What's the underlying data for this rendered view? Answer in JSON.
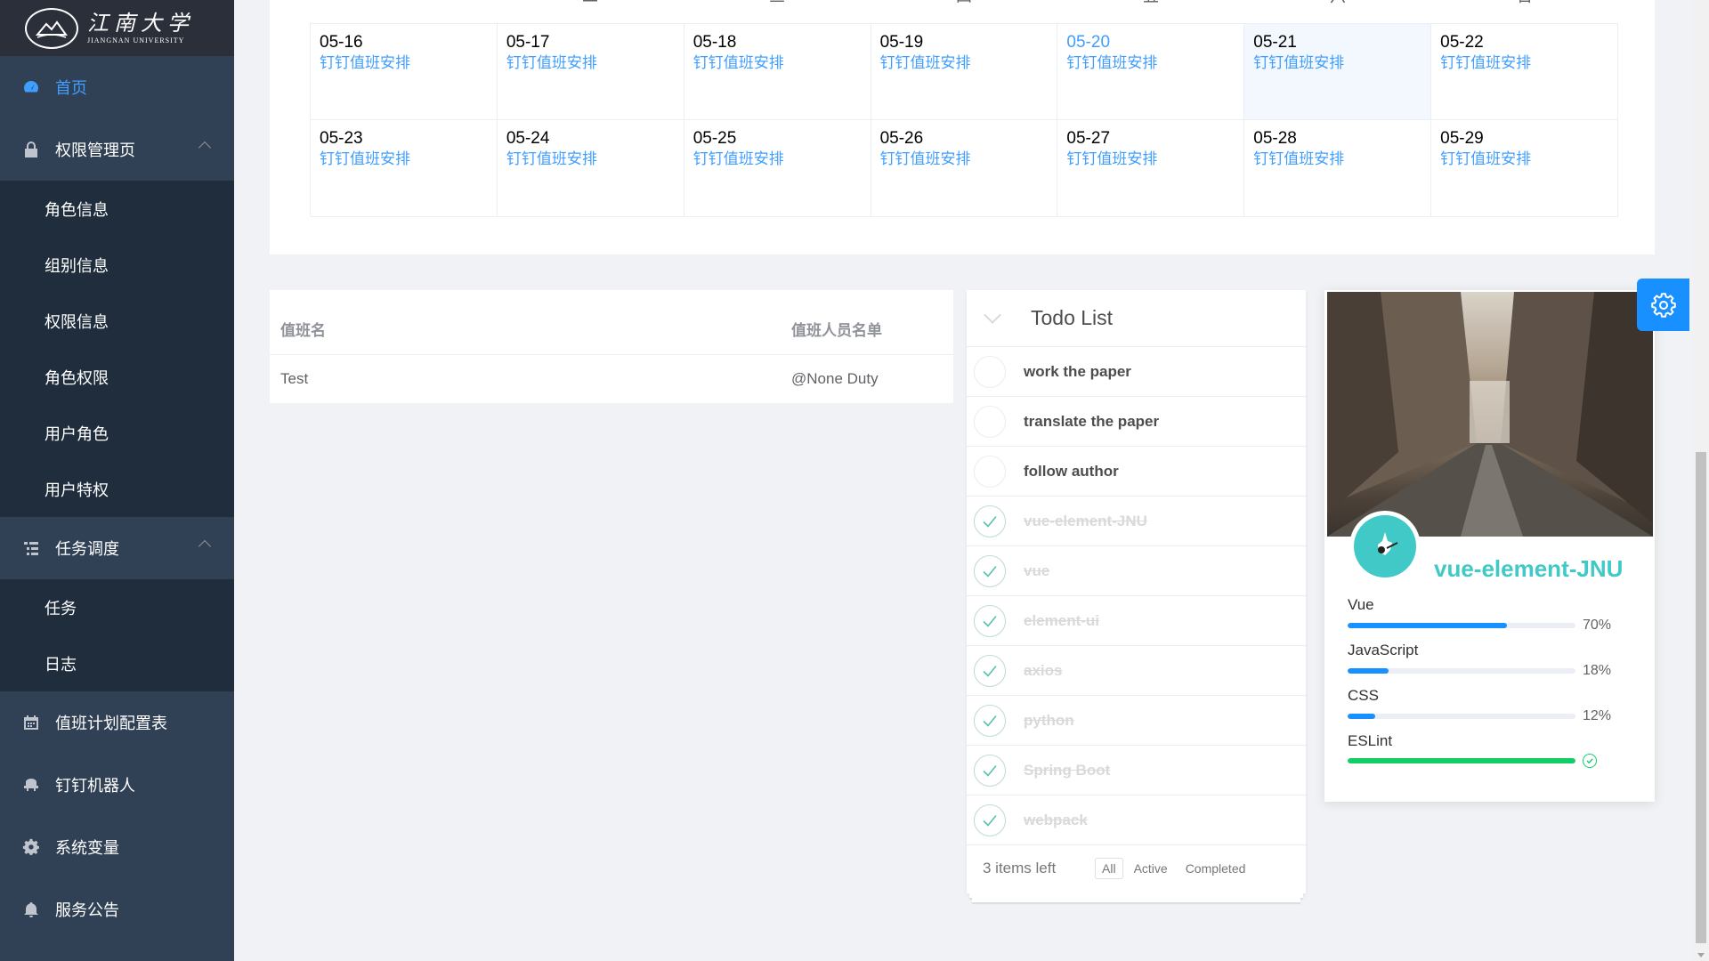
{
  "sidebar": {
    "logo": {
      "cn": "江南大学",
      "en": "JIANGNAN UNIVERSITY"
    },
    "home": {
      "label": "首页",
      "icon": "dashboard-icon"
    },
    "perm_group": {
      "label": "权限管理页",
      "icon": "lock-icon",
      "items": [
        "角色信息",
        "组别信息",
        "权限信息",
        "角色权限",
        "用户角色",
        "用户特权"
      ]
    },
    "task_group": {
      "label": "任务调度",
      "icon": "tree-table-icon",
      "items": [
        "任务",
        "日志"
      ]
    },
    "duty_plan": {
      "label": "值班计划配置表",
      "icon": "calendar-icon"
    },
    "dingtalk": {
      "label": "钉钉机器人",
      "icon": "robot-icon"
    },
    "sysvars": {
      "label": "系统变量",
      "icon": "gear-icon"
    },
    "notice": {
      "label": "服务公告",
      "icon": "bell-icon"
    }
  },
  "calendar": {
    "weekdays": [
      "二",
      "三",
      "四",
      "五",
      "六",
      "日"
    ],
    "today": "05-20",
    "selected": "05-21",
    "event_label": "钉钉值班安排",
    "rows": [
      [
        "05-16",
        "05-17",
        "05-18",
        "05-19",
        "05-20",
        "05-21",
        "05-22"
      ],
      [
        "05-23",
        "05-24",
        "05-25",
        "05-26",
        "05-27",
        "05-28",
        "05-29"
      ]
    ]
  },
  "duty_table": {
    "headers": [
      "值班名",
      "值班人员名单"
    ],
    "rows": [
      [
        "Test",
        "@None Duty"
      ]
    ]
  },
  "todo": {
    "title": "Todo List",
    "items": [
      {
        "text": "work the paper",
        "done": false
      },
      {
        "text": "translate the paper",
        "done": false
      },
      {
        "text": "follow author",
        "done": false
      },
      {
        "text": "vue-element-JNU",
        "done": true
      },
      {
        "text": "vue",
        "done": true
      },
      {
        "text": "element-ui",
        "done": true
      },
      {
        "text": "axios",
        "done": true
      },
      {
        "text": "python",
        "done": true
      },
      {
        "text": "Spring Boot",
        "done": true
      },
      {
        "text": "webpack",
        "done": true
      }
    ],
    "footer": {
      "count": "3 items left",
      "filters": [
        "All",
        "Active",
        "Completed"
      ],
      "selected_filter": "All"
    }
  },
  "profile": {
    "name": "vue-element-JNU",
    "skills": [
      {
        "label": "Vue",
        "percent": 70,
        "pct_text": "70%",
        "status": "normal"
      },
      {
        "label": "JavaScript",
        "percent": 18,
        "pct_text": "18%",
        "status": "normal"
      },
      {
        "label": "CSS",
        "percent": 12,
        "pct_text": "12%",
        "status": "normal"
      },
      {
        "label": "ESLint",
        "percent": 100,
        "pct_text": "",
        "status": "success"
      }
    ],
    "colors": {
      "accent": "#40c9c6",
      "bar": "#1890ff",
      "success": "#13ce66"
    }
  },
  "settings": {
    "icon": "gear-icon",
    "color": "#1890ff"
  }
}
